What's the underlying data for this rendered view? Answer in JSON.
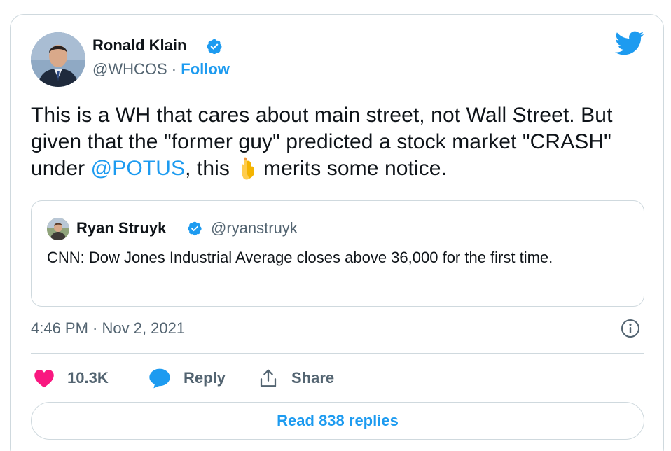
{
  "author": {
    "name": "Ronald Klain",
    "handle": "@WHCOS",
    "separator": "·",
    "follow_label": "Follow"
  },
  "tweet": {
    "text_part1": "This is a WH that cares about main street, not Wall Street. But given that the \"former guy\" predicted a stock market \"CRASH\" under ",
    "mention": "@POTUS",
    "text_part2": ", this",
    "text_part3": "merits some notice."
  },
  "quoted_tweet": {
    "name": "Ryan Struyk",
    "handle": "@ryanstruyk",
    "text": "CNN: Dow Jones Industrial Average closes above 36,000 for the first time."
  },
  "meta": {
    "timestamp": "4:46 PM · Nov 2, 2021"
  },
  "actions": {
    "likes": "10.3K",
    "reply_label": "Reply",
    "share_label": "Share",
    "read_replies_label": "Read 838 replies"
  },
  "colors": {
    "accent": "#1d9bf0",
    "like": "#f91880",
    "text": "#0f1419",
    "secondary": "#536471",
    "border": "#cfd9de"
  },
  "icons": {
    "logo": "twitter-bird-icon",
    "verified": "verified-badge-icon",
    "emoji": "backhand-index-pointing-down-icon",
    "info": "info-icon",
    "like": "heart-icon",
    "reply": "speech-bubble-icon",
    "share": "share-icon"
  }
}
